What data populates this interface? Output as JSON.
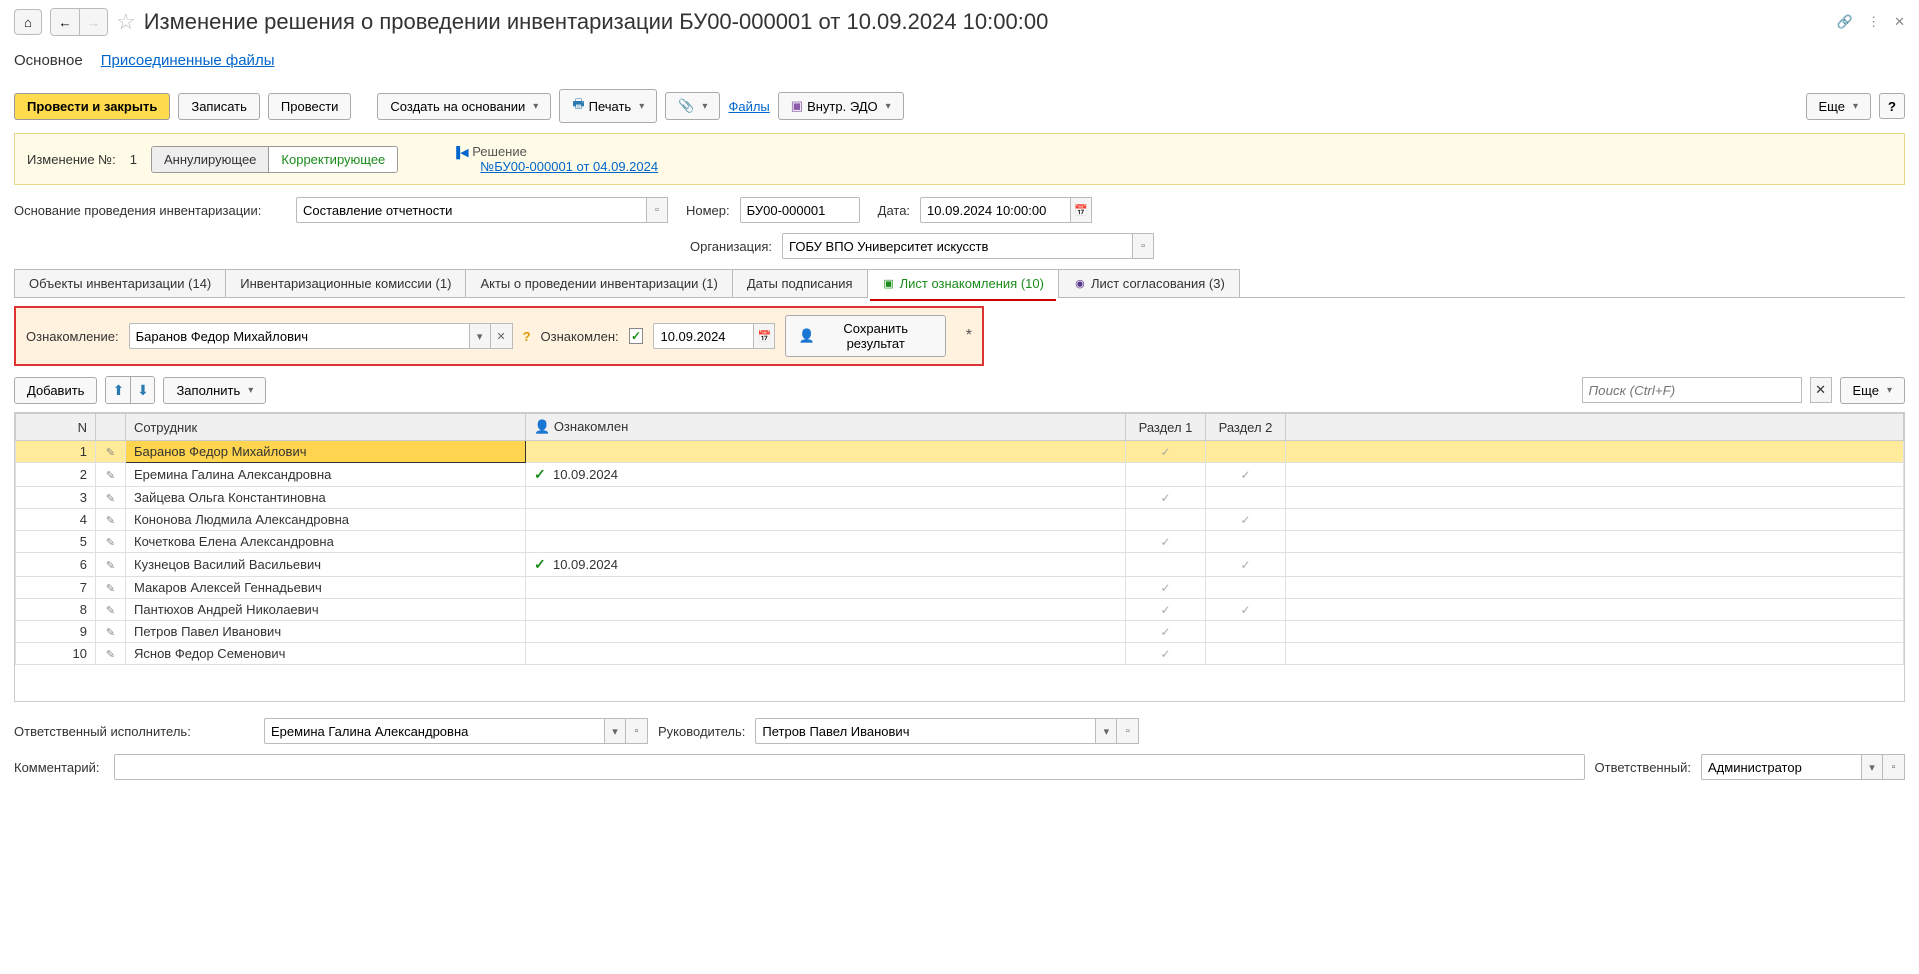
{
  "header": {
    "title": "Изменение решения о проведении инвентаризации БУ00-000001 от 10.09.2024 10:00:00"
  },
  "section_tabs": {
    "main": "Основное",
    "files": "Присоединенные файлы"
  },
  "toolbar": {
    "post_close": "Провести и закрыть",
    "save": "Записать",
    "post": "Провести",
    "create_based": "Создать на основании",
    "print": "Печать",
    "files_link": "Файлы",
    "internal_edo": "Внутр. ЭДО",
    "more": "Еще",
    "help": "?"
  },
  "change_box": {
    "label": "Изменение №:",
    "num": "1",
    "annul": "Аннулирующее",
    "corr": "Корректирующее",
    "decision_label": "Решение",
    "decision_link": "№БУ00-000001 от 04.09.2024"
  },
  "form": {
    "basis_label": "Основание проведения инвентаризации:",
    "basis_value": "Составление отчетности",
    "num_label": "Номер:",
    "num_value": "БУ00-000001",
    "date_label": "Дата:",
    "date_value": "10.09.2024 10:00:00",
    "org_label": "Организация:",
    "org_value": "ГОБУ ВПО Университет искусств"
  },
  "tabs": [
    "Объекты инвентаризации (14)",
    "Инвентаризационные комиссии (1)",
    "Акты о проведении инвентаризации (1)",
    "Даты подписания",
    "Лист ознакомления (10)",
    "Лист согласования (3)"
  ],
  "ack_panel": {
    "label": "Ознакомление:",
    "person": "Баранов Федор Михайлович",
    "ack_label": "Ознакомлен:",
    "date": "10.09.2024",
    "save_btn": "Сохранить результат",
    "star": "*",
    "help": "?"
  },
  "inner_toolbar": {
    "add": "Добавить",
    "fill": "Заполнить",
    "search_placeholder": "Поиск (Ctrl+F)",
    "more": "Еще"
  },
  "table": {
    "headers": {
      "n": "N",
      "employee": "Сотрудник",
      "ack": "Ознакомлен",
      "s1": "Раздел 1",
      "s2": "Раздел 2"
    },
    "rows": [
      {
        "n": 1,
        "name": "Баранов Федор Михайлович",
        "ack": "",
        "ack_check": false,
        "s1": true,
        "s2": false,
        "selected": true
      },
      {
        "n": 2,
        "name": "Еремина Галина Александровна",
        "ack": "10.09.2024",
        "ack_check": true,
        "s1": false,
        "s2": true,
        "selected": false
      },
      {
        "n": 3,
        "name": "Зайцева Ольга Константиновна",
        "ack": "",
        "ack_check": false,
        "s1": true,
        "s2": false,
        "selected": false
      },
      {
        "n": 4,
        "name": "Кононова Людмила Александровна",
        "ack": "",
        "ack_check": false,
        "s1": false,
        "s2": true,
        "selected": false
      },
      {
        "n": 5,
        "name": "Кочеткова Елена Александровна",
        "ack": "",
        "ack_check": false,
        "s1": true,
        "s2": false,
        "selected": false
      },
      {
        "n": 6,
        "name": "Кузнецов Василий Васильевич",
        "ack": "10.09.2024",
        "ack_check": true,
        "s1": false,
        "s2": true,
        "selected": false
      },
      {
        "n": 7,
        "name": "Макаров Алексей Геннадьевич",
        "ack": "",
        "ack_check": false,
        "s1": true,
        "s2": false,
        "selected": false
      },
      {
        "n": 8,
        "name": "Пантюхов Андрей Николаевич",
        "ack": "",
        "ack_check": false,
        "s1": true,
        "s2": true,
        "selected": false
      },
      {
        "n": 9,
        "name": "Петров Павел Иванович",
        "ack": "",
        "ack_check": false,
        "s1": true,
        "s2": false,
        "selected": false
      },
      {
        "n": 10,
        "name": "Яснов Федор Семенович",
        "ack": "",
        "ack_check": false,
        "s1": true,
        "s2": false,
        "selected": false
      }
    ]
  },
  "footer": {
    "resp_label": "Ответственный исполнитель:",
    "resp_value": "Еремина Галина Александровна",
    "head_label": "Руководитель:",
    "head_value": "Петров Павел Иванович",
    "comment_label": "Комментарий:",
    "comment_value": "",
    "owner_label": "Ответственный:",
    "owner_value": "Администратор"
  }
}
